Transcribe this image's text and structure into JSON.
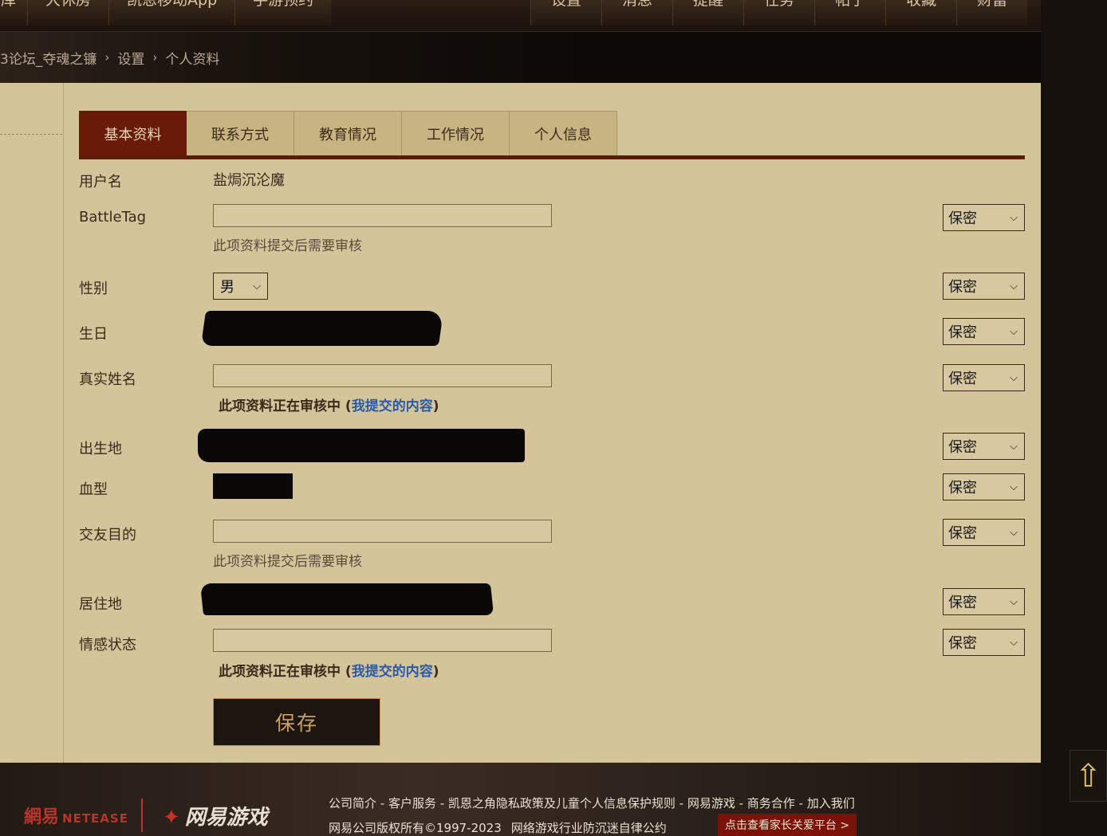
{
  "topnav": {
    "left_items": [
      "库",
      "大休房",
      "凯恩移动App",
      "手游预约"
    ],
    "right_items": [
      "设置",
      "消息",
      "提醒",
      "任务",
      "帖子",
      "收藏",
      "财富"
    ]
  },
  "breadcrumb": {
    "items": [
      "3论坛_夺魂之镰",
      "设置",
      "个人资料"
    ],
    "separator": "›"
  },
  "tabs": [
    "基本资料",
    "联系方式",
    "教育情况",
    "工作情况",
    "个人信息"
  ],
  "form": {
    "username_label": "用户名",
    "username_value": "盐焗沉沦魔",
    "battletag_label": "BattleTag",
    "battletag_value": "",
    "battletag_hint": "此项资料提交后需要审核",
    "gender_label": "性别",
    "gender_value": "男",
    "birthday_label": "生日",
    "realname_label": "真实姓名",
    "realname_value": "",
    "realname_review": "此项资料正在审核中 (",
    "realname_review_link": "我提交的内容",
    "realname_review_end": ")",
    "birthplace_label": "出生地",
    "bloodtype_label": "血型",
    "friend_label": "交友目的",
    "friend_value": "",
    "friend_hint": "此项资料提交后需要审核",
    "residence_label": "居住地",
    "relationship_label": "情感状态",
    "relationship_value": "",
    "relationship_review": "此项资料正在审核中 (",
    "relationship_review_link": "我提交的内容",
    "relationship_review_end": ")",
    "privacy_value": "保密",
    "save_label": "保存"
  },
  "footer": {
    "netease_logo": "網易",
    "netease_logo_en": "NETEASE",
    "games_logo": "网易游戏",
    "links": "公司简介 - 客户服务 - 凯恩之角隐私政策及儿童个人信息保护规则 - 网易游戏 - 商务合作 - 加入我们",
    "copyright": "网易公司版权所有©1997-2023",
    "anti_addiction": "网络游戏行业防沉迷自律公约",
    "parent_button": "点击查看家长关爱平台 >"
  },
  "icons": {
    "dropdown": "chevron-down-icon",
    "back_to_top": "arrow-up-icon"
  }
}
